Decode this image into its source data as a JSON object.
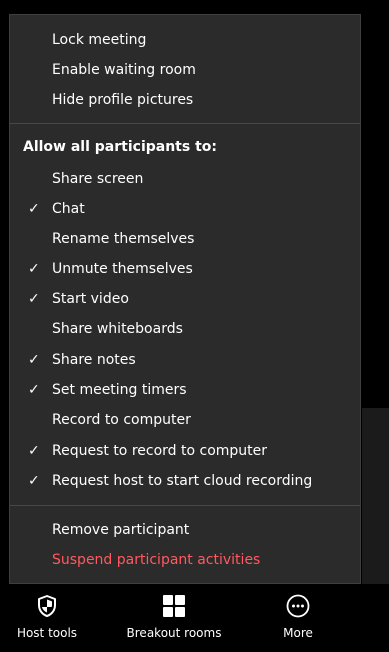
{
  "menu": {
    "top_items": [
      {
        "label": "Lock meeting",
        "checked": false
      },
      {
        "label": "Enable waiting room",
        "checked": false
      },
      {
        "label": "Hide profile pictures",
        "checked": false
      }
    ],
    "section_title": "Allow all participants to:",
    "participant_items": [
      {
        "label": "Share screen",
        "checked": false
      },
      {
        "label": "Chat",
        "checked": true
      },
      {
        "label": "Rename themselves",
        "checked": false
      },
      {
        "label": "Unmute themselves",
        "checked": true
      },
      {
        "label": "Start video",
        "checked": true
      },
      {
        "label": "Share whiteboards",
        "checked": false
      },
      {
        "label": "Share notes",
        "checked": true
      },
      {
        "label": "Set meeting timers",
        "checked": true
      },
      {
        "label": "Record to computer",
        "checked": false
      },
      {
        "label": "Request to record to computer",
        "checked": true
      },
      {
        "label": "Request host to start cloud recording",
        "checked": true
      }
    ],
    "bottom_items": [
      {
        "label": "Remove participant",
        "checked": false
      },
      {
        "label": "Suspend participant activities",
        "checked": false,
        "danger": true
      }
    ],
    "check_glyph": "✓"
  },
  "toolbar": {
    "host_tools": {
      "label": "Host tools",
      "icon": "shield-icon"
    },
    "breakout_rooms": {
      "label": "Breakout rooms",
      "icon": "grid-icon"
    },
    "more": {
      "label": "More",
      "icon": "ellipsis-circle-icon"
    }
  },
  "colors": {
    "menu_background": "#2b2b2b",
    "text": "#ffffff",
    "danger": "#ff5a5f",
    "divider": "#474747"
  }
}
